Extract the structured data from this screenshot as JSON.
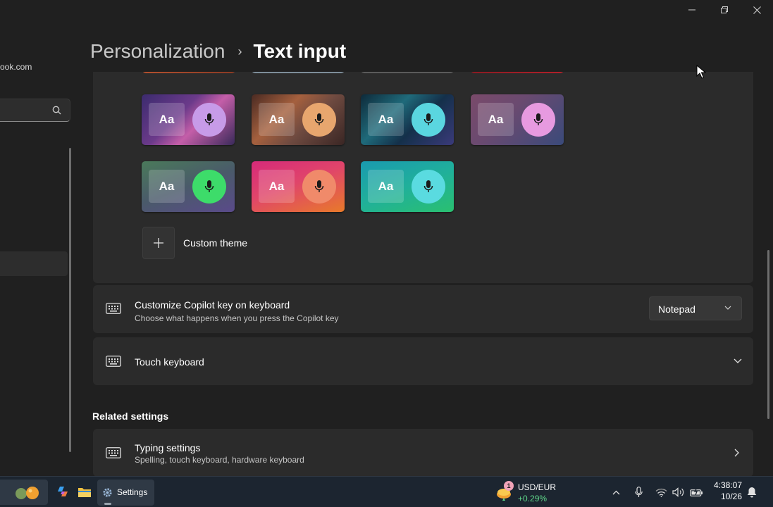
{
  "window": {
    "minimize_label": "Minimize",
    "restore_label": "Restore",
    "close_label": "Close"
  },
  "left_pane": {
    "account_email_fragment": "ook.com"
  },
  "breadcrumb": {
    "parent": "Personalization",
    "separator": "›",
    "current": "Text input"
  },
  "themes": {
    "custom_theme_label": "Custom theme",
    "aa_label": "Aa"
  },
  "copilot_key": {
    "title": "Customize Copilot key on keyboard",
    "subtitle": "Choose what happens when you press the Copilot key",
    "selected_value": "Notepad"
  },
  "touch_keyboard": {
    "title": "Touch keyboard"
  },
  "related": {
    "heading": "Related settings",
    "typing_title": "Typing settings",
    "typing_subtitle": "Spelling, touch keyboard, hardware keyboard"
  },
  "taskbar": {
    "settings_label": "Settings",
    "widget_badge": "1",
    "widget_title": "USD/EUR",
    "widget_value": "+0.29%",
    "time": "4:38:07",
    "date": "10/26"
  }
}
